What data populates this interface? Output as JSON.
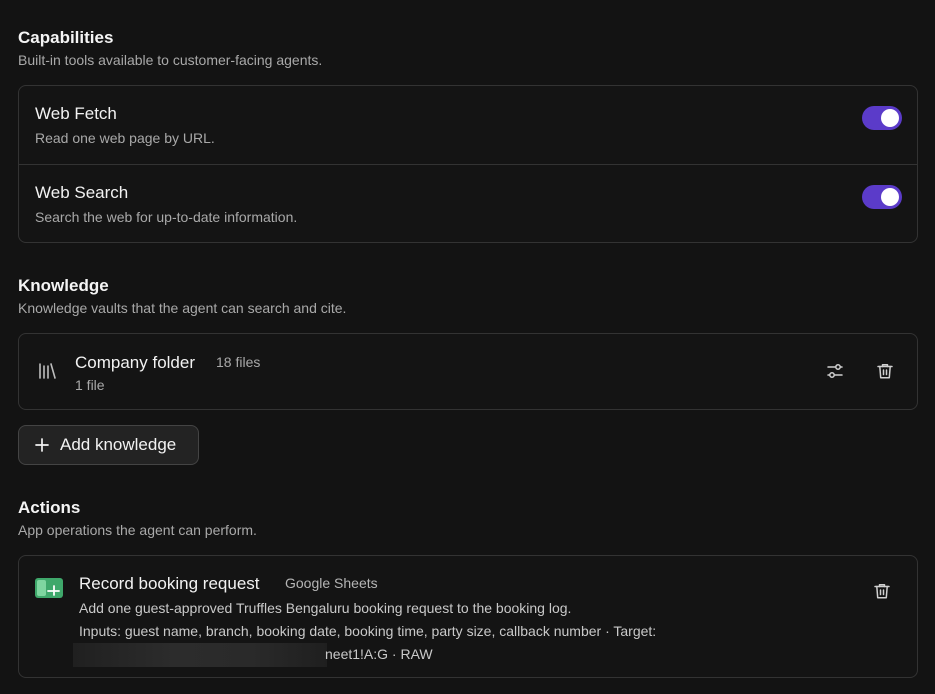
{
  "capabilities": {
    "title": "Capabilities",
    "subtitle": "Built-in tools available to customer-facing agents.",
    "items": [
      {
        "name": "Web Fetch",
        "description": "Read one web page by URL.",
        "enabled": true
      },
      {
        "name": "Web Search",
        "description": "Search the web for up-to-date information.",
        "enabled": true
      }
    ],
    "toggle_color": "#5b3bc9"
  },
  "knowledge": {
    "title": "Knowledge",
    "subtitle": "Knowledge vaults that the agent can search and cite.",
    "vaults": [
      {
        "name": "Company folder",
        "count": "18 files",
        "sub": "1 file",
        "icon": "library-icon"
      }
    ],
    "add_label": "Add knowledge"
  },
  "actions": {
    "title": "Actions",
    "subtitle": "App operations the agent can perform.",
    "items": [
      {
        "title": "Record booking request",
        "app": "Google Sheets",
        "icon": "google-sheets-icon",
        "description": "Add one guest-approved Truffles Bengaluru booking request to the booking log.",
        "inputs": "Inputs: guest name, branch, booking date, booking time, party size, callback number · Target:",
        "target_tail": "neet1!A:G · RAW"
      }
    ]
  }
}
